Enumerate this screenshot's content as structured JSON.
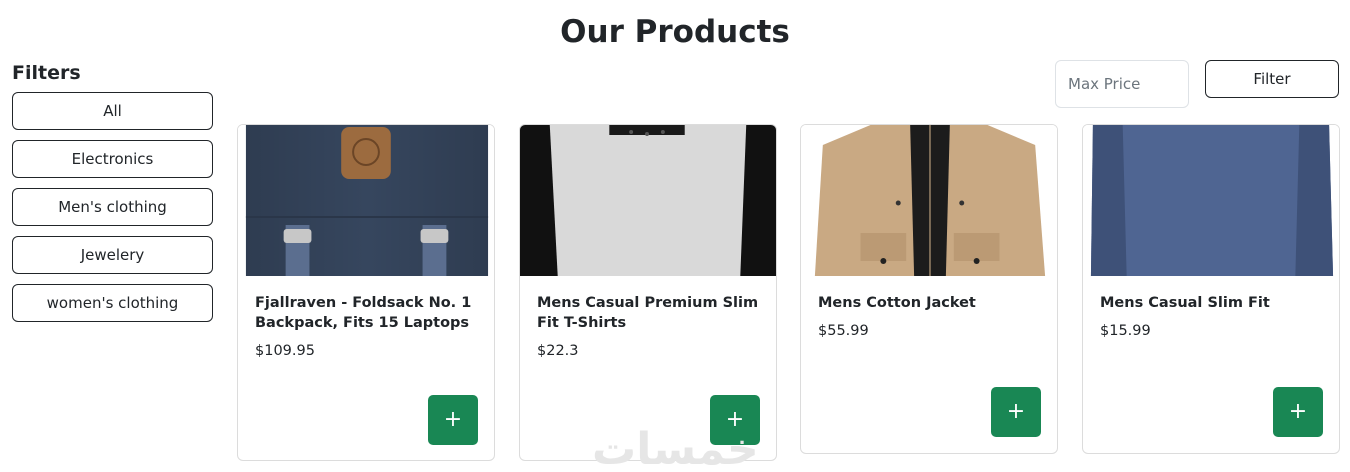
{
  "page": {
    "title": "Our Products"
  },
  "filters": {
    "heading": "Filters",
    "categories": [
      "All",
      "Electronics",
      "Men's clothing",
      "Jewelery",
      "women's clothing"
    ]
  },
  "price_filter": {
    "placeholder": "Max Price",
    "button_label": "Filter"
  },
  "products": [
    {
      "title": "Fjallraven - Foldsack No. 1 Backpack, Fits 15 Laptops",
      "price": "$109.95",
      "add_label": "+"
    },
    {
      "title": "Mens Casual Premium Slim Fit T-Shirts",
      "price": "$22.3",
      "add_label": "+"
    },
    {
      "title": "Mens Cotton Jacket",
      "price": "$55.99",
      "add_label": "+"
    },
    {
      "title": "Mens Casual Slim Fit",
      "price": "$15.99",
      "add_label": "+"
    }
  ],
  "watermark": "خمسات",
  "colors": {
    "accent_green": "#198754",
    "text": "#212529",
    "border": "#dcdcdc"
  }
}
